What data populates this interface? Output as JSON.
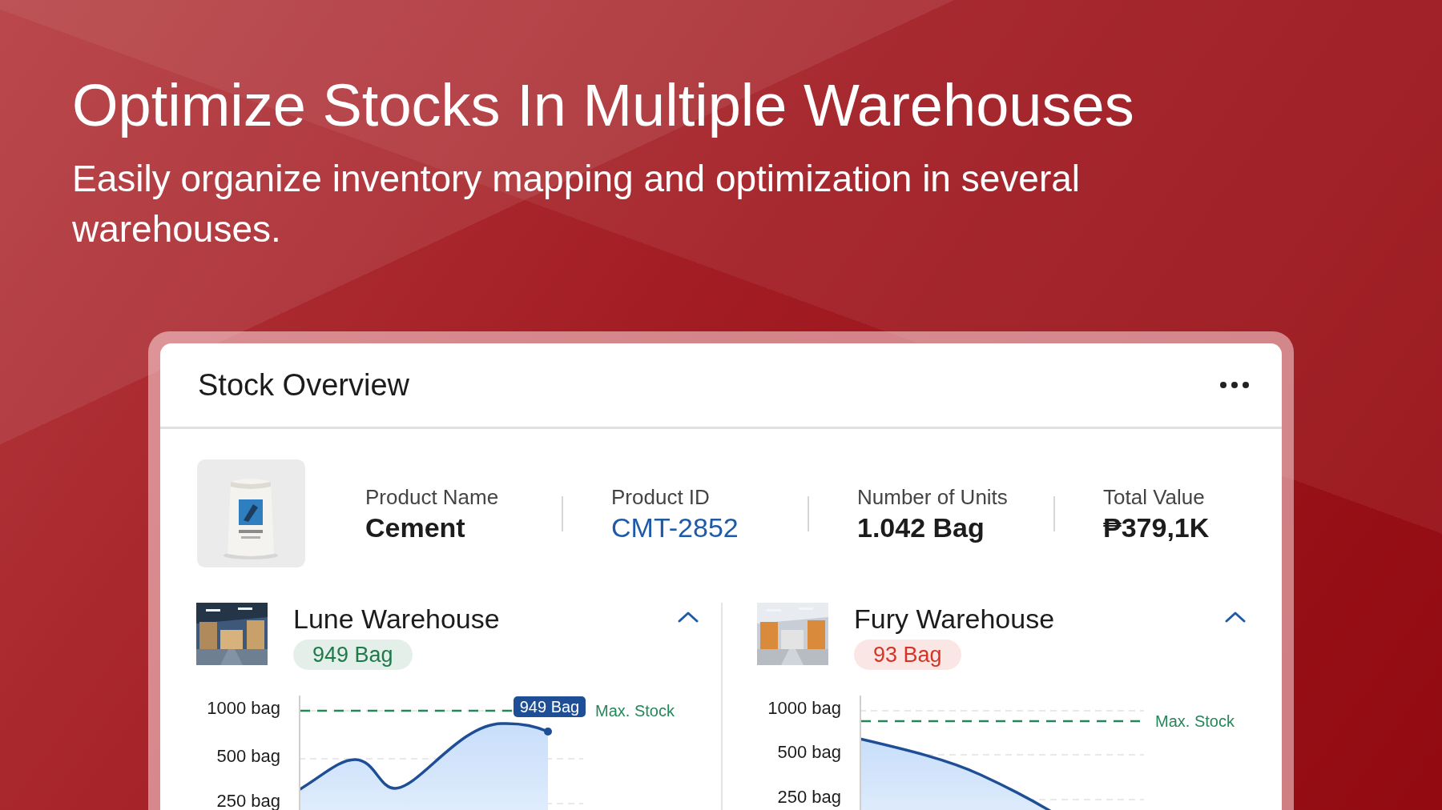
{
  "headline": "Optimize Stocks In Multiple Warehouses",
  "subtitle": "Easily organize inventory mapping and optimization in several warehouses.",
  "card": {
    "title": "Stock Overview",
    "fields": [
      {
        "label": "Product Name",
        "value": "Cement",
        "kind": "text"
      },
      {
        "label": "Product ID",
        "value": "CMT-2852",
        "kind": "link"
      },
      {
        "label": "Number of Units",
        "value": "1.042 Bag",
        "kind": "text"
      },
      {
        "label": "Total Value",
        "value": "₱379,1K",
        "kind": "text"
      }
    ],
    "warehouses": [
      {
        "name": "Lune Warehouse",
        "stock": "949 Bag",
        "color": "#1e7a4a",
        "expanded": true,
        "y_labels": [
          "1000 bag",
          "500 bag",
          "250 bag"
        ],
        "max_label": "Max. Stock",
        "tooltip": "949 Bag",
        "kind": "rising"
      },
      {
        "name": "Fury Warehouse",
        "stock": "93 Bag",
        "color": "#d63325",
        "expanded": true,
        "y_labels": [
          "1000 bag",
          "500 bag",
          "250 bag"
        ],
        "max_label": "Max. Stock",
        "kind": "falling"
      }
    ]
  }
}
